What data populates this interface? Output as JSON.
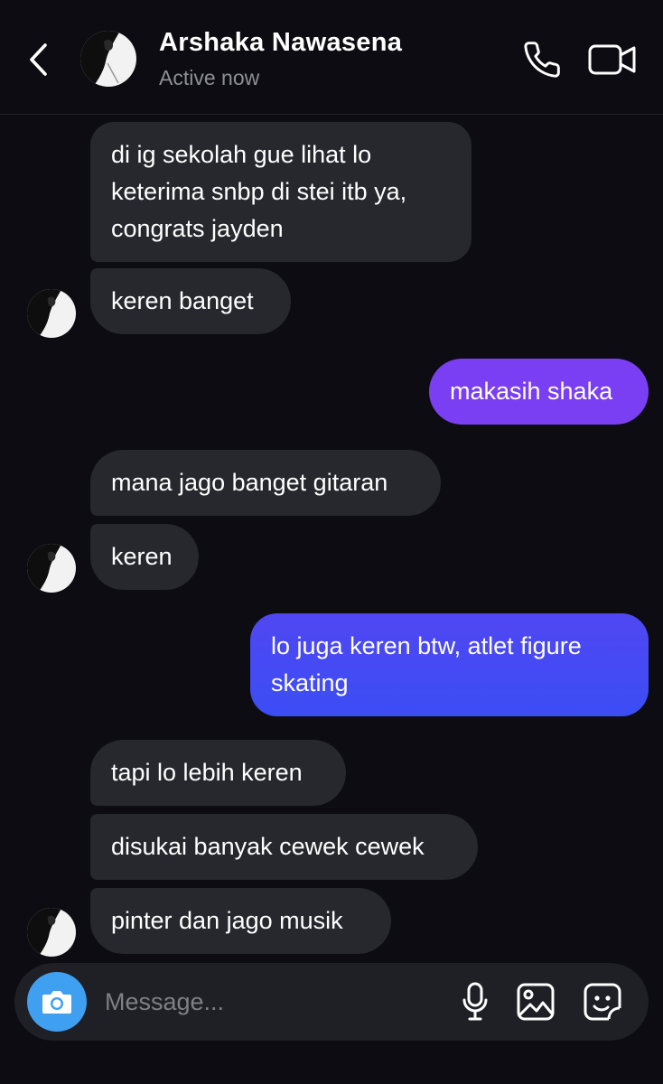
{
  "header": {
    "back_icon": "chevron-left-icon",
    "contact_name": "Arshaka Nawasena",
    "status": "Active now",
    "call_icon": "phone-icon",
    "video_icon": "video-camera-icon"
  },
  "messages": [
    {
      "sender": "contact",
      "lines": [
        "di ig sekolah gue lihat lo",
        "keterima snbp di stei itb ya,",
        "congrats jayden"
      ]
    },
    {
      "sender": "contact",
      "lines": [
        "keren banget"
      ]
    },
    {
      "sender": "me",
      "lines": [
        "makasih shaka"
      ]
    },
    {
      "sender": "contact",
      "lines": [
        "mana jago banget gitaran"
      ]
    },
    {
      "sender": "contact",
      "lines": [
        "keren"
      ]
    },
    {
      "sender": "me",
      "lines": [
        "lo juga keren btw, atlet figure",
        "skating"
      ]
    },
    {
      "sender": "contact",
      "lines": [
        "tapi lo lebih keren"
      ]
    },
    {
      "sender": "contact",
      "lines": [
        "disukai banyak cewek cewek"
      ]
    },
    {
      "sender": "contact",
      "lines": [
        "pinter dan jago musik"
      ]
    }
  ],
  "composer": {
    "placeholder": "Message...",
    "value": "",
    "camera_icon": "camera-icon",
    "mic_icon": "microphone-icon",
    "gallery_icon": "image-icon",
    "sticker_icon": "sticker-icon"
  },
  "colors": {
    "background": "#0c0c12",
    "incoming_bubble": "#26282d",
    "outgoing_gradient_top": "#7a3ff2",
    "outgoing_gradient_bottom": "#3d4cf5",
    "camera_button": "#3f9ff1",
    "secondary_text": "#8e8f96"
  }
}
